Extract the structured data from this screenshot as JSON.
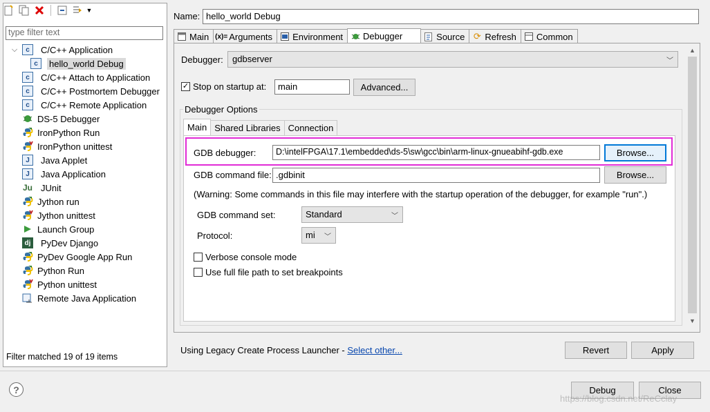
{
  "left": {
    "filter_placeholder": "type filter text",
    "filter_status": "Filter matched 19 of 19 items",
    "tree": [
      {
        "label": "C/C++ Application",
        "expanded": true,
        "icon": "c-app-icon"
      },
      {
        "label": "hello_world Debug",
        "child": true,
        "selected": true,
        "icon": "c-app-icon"
      },
      {
        "label": "C/C++ Attach to Application",
        "icon": "c-app-icon"
      },
      {
        "label": "C/C++ Postmortem Debugger",
        "icon": "c-app-icon"
      },
      {
        "label": "C/C++ Remote Application",
        "icon": "c-app-icon"
      },
      {
        "label": "DS-5 Debugger",
        "icon": "ds5-icon"
      },
      {
        "label": "IronPython Run",
        "icon": "python-icon"
      },
      {
        "label": "IronPython unittest",
        "icon": "python-unittest-icon"
      },
      {
        "label": "Java Applet",
        "icon": "java-applet-icon"
      },
      {
        "label": "Java Application",
        "icon": "java-app-icon"
      },
      {
        "label": "JUnit",
        "icon": "junit-icon"
      },
      {
        "label": "Jython run",
        "icon": "python-icon"
      },
      {
        "label": "Jython unittest",
        "icon": "python-unittest-icon"
      },
      {
        "label": "Launch Group",
        "icon": "launch-group-icon"
      },
      {
        "label": "PyDev Django",
        "icon": "django-icon"
      },
      {
        "label": "PyDev Google App Run",
        "icon": "python-icon"
      },
      {
        "label": "Python Run",
        "icon": "python-icon"
      },
      {
        "label": "Python unittest",
        "icon": "python-unittest-icon"
      },
      {
        "label": "Remote Java Application",
        "icon": "remote-java-icon"
      }
    ]
  },
  "name": {
    "label": "Name:",
    "value": "hello_world Debug"
  },
  "tabs": [
    "Main",
    "Arguments",
    "Environment",
    "Debugger",
    "Source",
    "Refresh",
    "Common"
  ],
  "debugger": {
    "label": "Debugger:",
    "value": "gdbserver",
    "stop_label": "Stop on startup at:",
    "stop_value": "main",
    "advanced": "Advanced..."
  },
  "options": {
    "legend": "Debugger Options",
    "subtabs": [
      "Main",
      "Shared Libraries",
      "Connection"
    ],
    "gdb_label": "GDB debugger:",
    "gdb_value": "D:\\intelFPGA\\17.1\\embedded\\ds-5\\sw\\gcc\\bin\\arm-linux-gnueabihf-gdb.exe",
    "browse": "Browse...",
    "gdbcmd_label": "GDB command file:",
    "gdbcmd_value": ".gdbinit",
    "warning": "(Warning: Some commands in this file may interfere with the startup operation of the debugger, for example \"run\".)",
    "cmdset_label": "GDB command set:",
    "cmdset_value": "Standard",
    "protocol_label": "Protocol:",
    "protocol_value": "mi",
    "verbose": "Verbose console mode",
    "fullpath": "Use full file path to set breakpoints"
  },
  "footer": {
    "launcher_text": "Using Legacy Create Process Launcher - ",
    "launcher_link": "Select other...",
    "revert": "Revert",
    "apply": "Apply",
    "debug": "Debug",
    "close": "Close",
    "watermark": "https://blog.csdn.net/ReCclay"
  },
  "colors": {
    "highlight": "#e12bd6",
    "focus": "#0078d7"
  }
}
